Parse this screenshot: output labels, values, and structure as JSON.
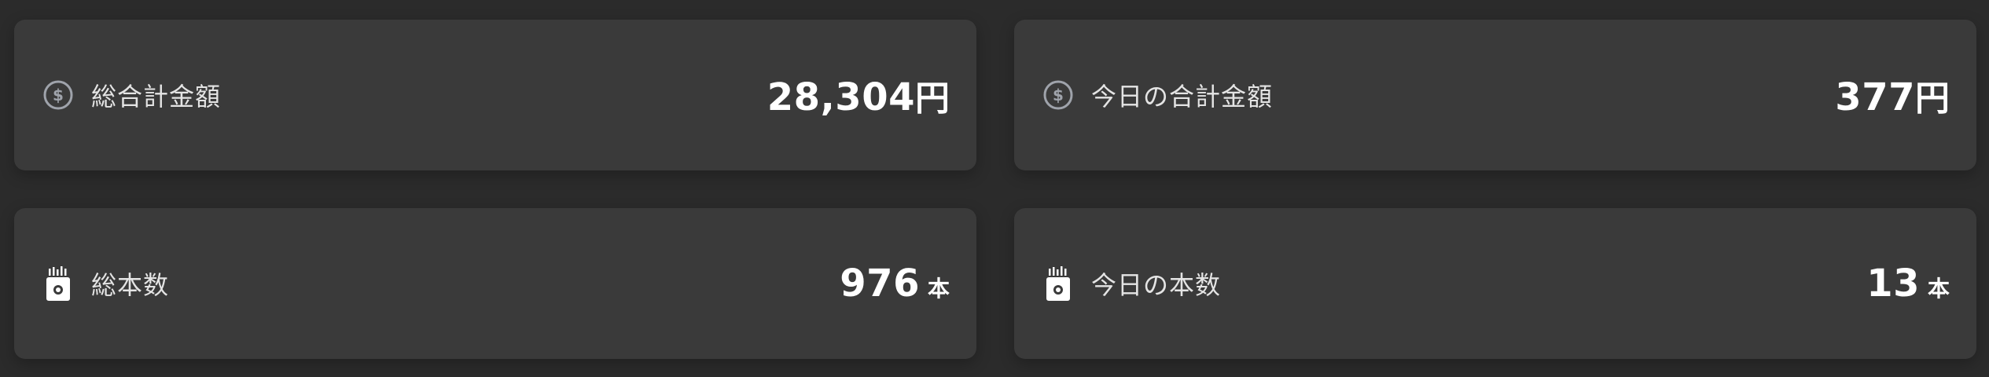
{
  "cards": [
    {
      "label": "総合計金額",
      "value": "28,304",
      "unit": "円",
      "icon": "dollar-circle-icon"
    },
    {
      "label": "今日の合計金額",
      "value": "377",
      "unit": "円",
      "icon": "dollar-circle-icon"
    },
    {
      "label": "総本数",
      "value": "976",
      "unit": "本",
      "icon": "cigarette-pack-icon"
    },
    {
      "label": "今日の本数",
      "value": "13",
      "unit": "本",
      "icon": "cigarette-pack-icon"
    }
  ],
  "colors": {
    "background": "#2b2b2b",
    "card": "#3a3a3a",
    "text": "#ffffff",
    "icon": "#9fa3ab"
  }
}
